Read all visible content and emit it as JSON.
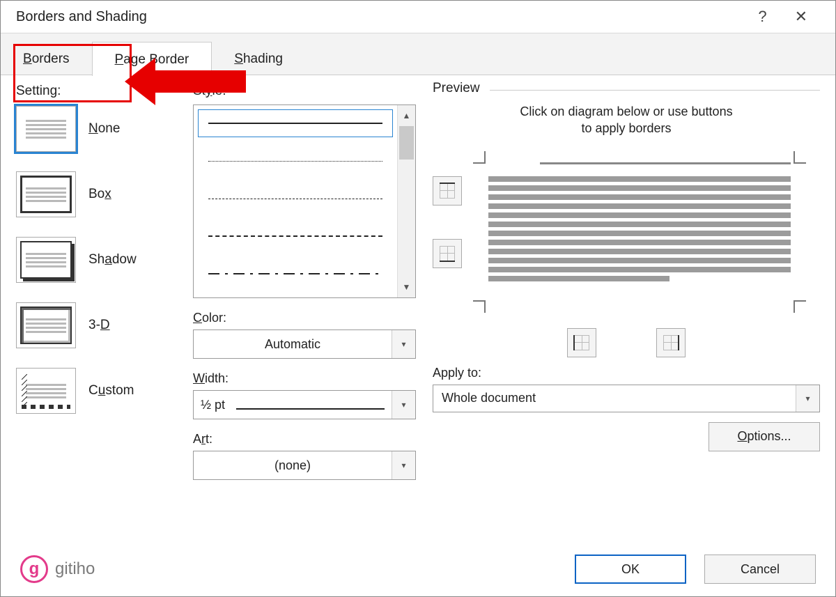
{
  "window": {
    "title": "Borders and Shading",
    "help_label": "?",
    "close_label": "✕"
  },
  "tabs": {
    "borders": "Borders",
    "page_border": "Page Border",
    "shading": "Shading",
    "active": "page_border"
  },
  "setting": {
    "heading": "Setting:",
    "items": [
      {
        "label": "None",
        "kind": "none",
        "selected": true
      },
      {
        "label": "Box",
        "kind": "box",
        "selected": false
      },
      {
        "label": "Shadow",
        "kind": "shadow",
        "selected": false
      },
      {
        "label": "3-D",
        "kind": "3d",
        "selected": false
      },
      {
        "label": "Custom",
        "kind": "custom",
        "selected": false
      }
    ]
  },
  "style": {
    "heading": "Style:",
    "selected_index": 0,
    "options": [
      "solid",
      "dotted",
      "dashed1",
      "dashed2",
      "dashdot"
    ]
  },
  "color": {
    "heading": "Color:",
    "value": "Automatic"
  },
  "width": {
    "heading": "Width:",
    "value": "½ pt"
  },
  "art": {
    "heading": "Art:",
    "value": "(none)"
  },
  "preview": {
    "heading": "Preview",
    "instructions_line1": "Click on diagram below or use buttons",
    "instructions_line2": "to apply borders"
  },
  "apply_to": {
    "heading": "Apply to:",
    "value": "Whole document"
  },
  "buttons": {
    "options": "Options...",
    "ok": "OK",
    "cancel": "Cancel"
  },
  "watermark": {
    "text": "gitiho",
    "glyph": "g"
  },
  "annotations": {
    "red_box_target": "tab-borders",
    "red_arrow_direction": "left"
  },
  "colors": {
    "accent_blue": "#0b63c4",
    "annotation_red": "#e60000"
  }
}
